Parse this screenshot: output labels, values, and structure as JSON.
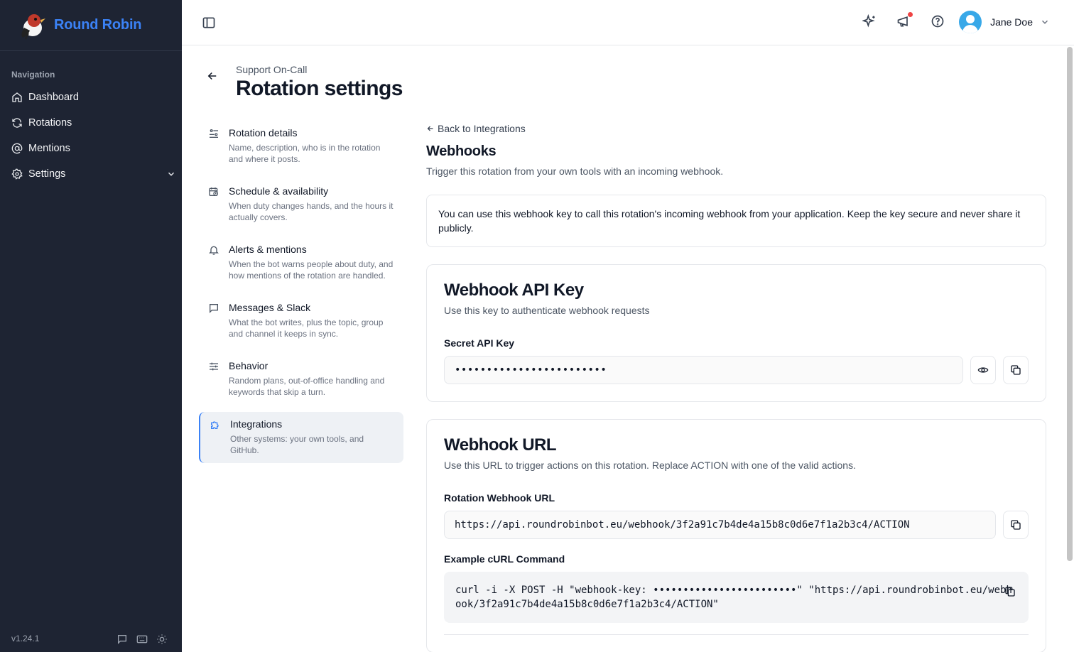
{
  "app": {
    "name": "Round Robin",
    "version": "v1.24.1"
  },
  "sidebar": {
    "heading": "Navigation",
    "items": [
      {
        "label": "Dashboard",
        "icon": "home-icon"
      },
      {
        "label": "Rotations",
        "icon": "refresh-icon"
      },
      {
        "label": "Mentions",
        "icon": "at-sign-icon"
      },
      {
        "label": "Settings",
        "icon": "gear-icon"
      }
    ]
  },
  "topbar": {
    "user_name": "Jane Doe"
  },
  "header": {
    "subtitle": "Support On-Call",
    "title": "Rotation settings"
  },
  "settings_menu": [
    {
      "title": "Rotation details",
      "desc": "Name, description, who is in the rotation and where it posts.",
      "icon": "sliders-icon"
    },
    {
      "title": "Schedule & availability",
      "desc": "When duty changes hands, and the hours it actually covers.",
      "icon": "calendar-clock-icon"
    },
    {
      "title": "Alerts & mentions",
      "desc": "When the bot warns people about duty, and how mentions of the rotation are handled.",
      "icon": "bell-icon"
    },
    {
      "title": "Messages & Slack",
      "desc": "What the bot writes, plus the topic, group and channel it keeps in sync.",
      "icon": "message-square-icon"
    },
    {
      "title": "Behavior",
      "desc": "Random plans, out-of-office handling and keywords that skip a turn.",
      "icon": "settings-sliders-icon"
    },
    {
      "title": "Integrations",
      "desc": "Other systems: your own tools, and GitHub.",
      "icon": "puzzle-icon",
      "active": true
    }
  ],
  "main": {
    "back_link": "Back to Integrations",
    "title": "Webhooks",
    "subtitle": "Trigger this rotation from your own tools with an incoming webhook.",
    "info": "You can use this webhook key to call this rotation's incoming webhook from your application. Keep the key secure and never share it publicly.",
    "api_key_card": {
      "title": "Webhook API Key",
      "subtitle": "Use this key to authenticate webhook requests",
      "label": "Secret API Key",
      "value": "••••••••••••••••••••••••"
    },
    "url_card": {
      "title": "Webhook URL",
      "subtitle": "Use this URL to trigger actions on this rotation. Replace ACTION with one of the valid actions.",
      "label": "Rotation Webhook URL",
      "value": "https://api.roundrobinbot.eu/webhook/3f2a91c7b4de4a15b8c0d6e7f1a2b3c4/ACTION",
      "curl_label": "Example cURL Command",
      "curl": "curl -i -X POST -H \"webhook-key: ••••••••••••••••••••••••\" \"https://api.roundrobinbot.eu/webhook/3f2a91c7b4de4a15b8c0d6e7f1a2b3c4/ACTION\""
    }
  },
  "colors": {
    "sidebar_bg": "#1e2433",
    "accent": "#3b82f6",
    "notification": "#ef4444"
  }
}
